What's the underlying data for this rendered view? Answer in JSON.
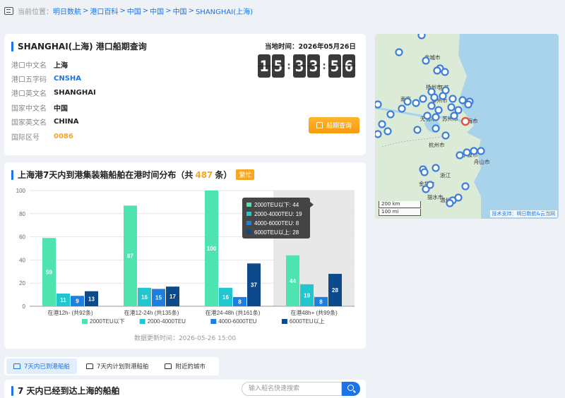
{
  "breadcrumb": {
    "prefix": "当前位置：",
    "items": [
      "明日数航",
      "港口百科",
      "中国",
      "中国",
      "中国",
      "SHANGHAI(上海)"
    ]
  },
  "port_card": {
    "title": "SHANGHAI(上海) 港口船期查询",
    "rows": [
      {
        "label": "港口中文名",
        "value": "上海"
      },
      {
        "label": "港口五字码",
        "value": "CNSHA"
      },
      {
        "label": "港口英文名",
        "value": "SHANGHAI"
      },
      {
        "label": "国家中文名",
        "value": "中国"
      },
      {
        "label": "国家英文名",
        "value": "CHINA"
      },
      {
        "label": "国际区号",
        "value": "0086"
      }
    ],
    "local_time_label": "当地时间：2026年05月26日",
    "clock_digits": [
      "1",
      "5",
      "3",
      "3",
      "5",
      "6"
    ],
    "schedule_button": "船期查询"
  },
  "map": {
    "labels": {
      "l1": "盐城市",
      "l2": "扬州市",
      "l3": "江苏",
      "l4": "泰州市",
      "l5": "南京",
      "l6": "无锡市",
      "l7": "苏州市",
      "l8": "上海市",
      "l9": "杭州市",
      "l10": "宁波市",
      "l11": "舟山市",
      "l12": "浙江",
      "l13": "金华市",
      "l14": "丽水市",
      "l15": "温州市"
    },
    "scale_km": "200 km",
    "scale_mi": "100 mi",
    "credit": "技术支持：明日数航&云当网",
    "colors": {
      "land": "#dcebd7",
      "sea": "#a9d3ea",
      "pin": "#3d7fd9",
      "current_pin": "#e5533d"
    }
  },
  "chart_card": {
    "title_prefix": "上海港7天内到港集装箱船舶在港时间分布（共",
    "count": "487",
    "title_suffix": "条）",
    "busy_badge": "繁忙",
    "updated": "数据更新时间：2026-05-26 15:00"
  },
  "chart_data": {
    "type": "bar",
    "categories": [
      "在港12h- (共92条)",
      "在港12-24h (共135条)",
      "在港24-48h (共161条)",
      "在港48h+ (共99条)"
    ],
    "series": [
      {
        "name": "2000TEU以下",
        "values": [
          59,
          87,
          100,
          44
        ],
        "color": "#4fe3b0"
      },
      {
        "name": "2000-4000TEU",
        "values": [
          11,
          16,
          16,
          19
        ],
        "color": "#22c6cf"
      },
      {
        "name": "4000-6000TEU",
        "values": [
          9,
          15,
          8,
          8
        ],
        "color": "#1d7fe0"
      },
      {
        "name": "6000TEU以上",
        "values": [
          13,
          17,
          37,
          28
        ],
        "color": "#0d4a8c"
      }
    ],
    "ylim": [
      0,
      100
    ],
    "yticks": [
      0,
      20,
      40,
      60,
      80,
      100
    ],
    "highlight_category": 3,
    "tooltip": [
      "2000TEU以下: 44",
      "2000-4000TEU: 19",
      "4000-6000TEU: 8",
      "6000TEU以上: 28"
    ],
    "legend_position": "bottom",
    "grid": true
  },
  "tabs": [
    {
      "label": "7天内已到港船舶",
      "active": true
    },
    {
      "label": "7天内计划到港船舶",
      "active": false
    },
    {
      "label": "附近的城市",
      "active": false
    }
  ],
  "arrived_card": {
    "title": "7 天内已经到达上海的船舶",
    "search_placeholder": "输入船名快速搜索"
  }
}
